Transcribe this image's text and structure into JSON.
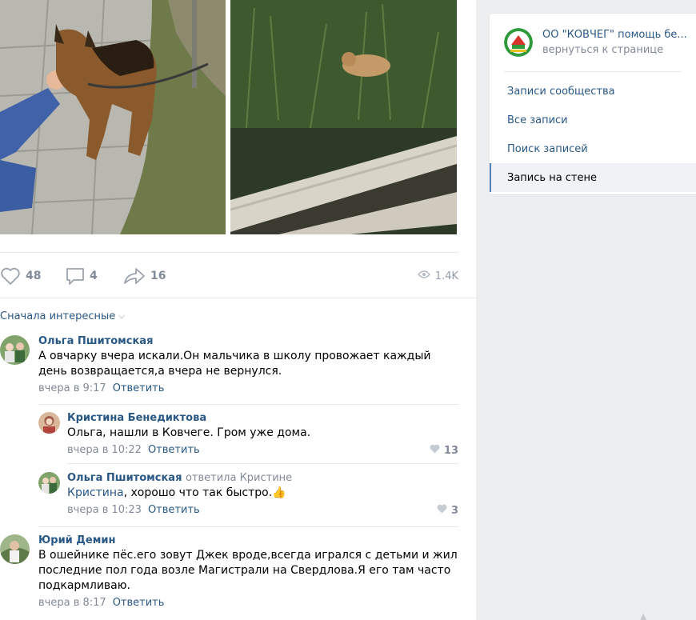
{
  "stats": {
    "likes": "48",
    "comments": "4",
    "shares": "16",
    "views": "1.4K"
  },
  "comments_section": {
    "sort_label": "Сначала интересные",
    "reply_label": "Ответить",
    "items": [
      {
        "author": "Ольга Пшитомская",
        "text": "А овчарку вчера искали.Он мальчика в школу провожает каждый день возвращается,а вчера не вернулся.",
        "time": "вчера в 9:17"
      },
      {
        "author": "Кристина Бенедиктова",
        "text": "Ольга, нашли в Ковчеге. Гром уже дома.",
        "time": "вчера в 10:22",
        "likes": "13"
      },
      {
        "author": "Ольга Пшитомская",
        "reply_to": "ответила Кристине",
        "mention": "Кристина",
        "text": ", хорошо что так быстро.",
        "time": "вчера в 10:23",
        "likes": "3"
      },
      {
        "author": "Юрий Демин",
        "text": "В ошейнике пёс.его зовут Джек вроде,всегда игрался с детьми и жил последние пол года возле Магистрали на Свердлова.Я его там часто подкармливаю.",
        "time": "вчера в 8:17"
      }
    ]
  },
  "sidebar": {
    "group_title": "ОО \"КОВЧЕГ\" помощь бе...",
    "group_back": "вернуться к странице",
    "menu": [
      "Записи сообщества",
      "Все записи",
      "Поиск записей",
      "Запись на стене"
    ]
  },
  "colors": {
    "link": "#2a5885",
    "muted": "#828a99",
    "background": "#edeef0",
    "active_marker": "#5181b8"
  },
  "icons": [
    "heart-icon",
    "comment-icon",
    "share-icon",
    "eye-icon",
    "thumbs-up-emoji",
    "chevron-down-icon"
  ]
}
